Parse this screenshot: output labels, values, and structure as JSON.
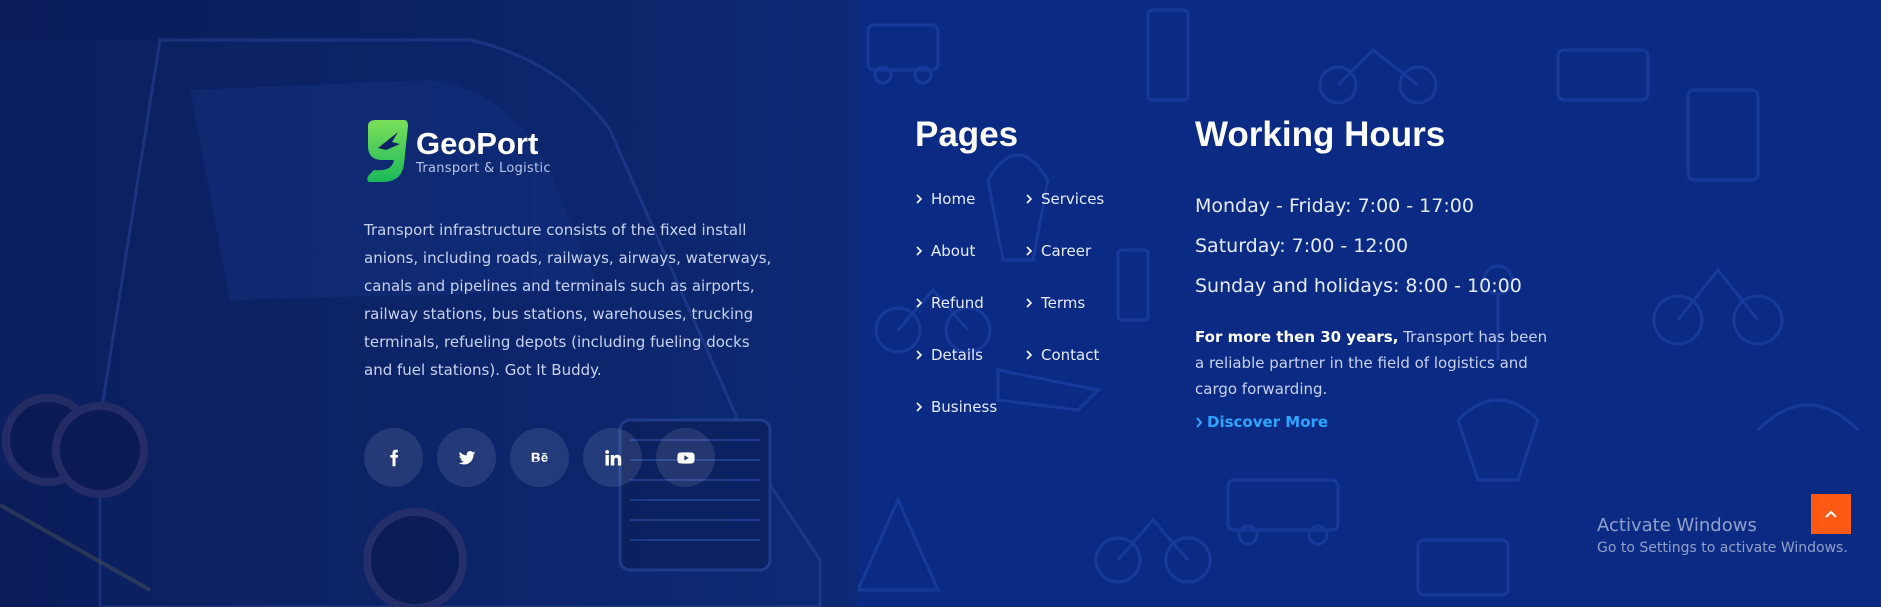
{
  "brand": {
    "name": "GeoPort",
    "tagline": "Transport & Logistic",
    "logo_icon": "plane-leaf-logo-icon",
    "accent": "#3fd15a"
  },
  "about": {
    "text": "Transport infrastructure consists of the fixed install anions, including roads, railways, airways, waterways, canals and pipelines and terminals such as airports, railway stations, bus stations, warehouses, trucking terminals, refueling depots (including fueling docks and fuel stations). Got It Buddy."
  },
  "socials": [
    {
      "icon": "facebook-icon"
    },
    {
      "icon": "twitter-icon"
    },
    {
      "icon": "behance-icon"
    },
    {
      "icon": "linkedin-icon"
    },
    {
      "icon": "youtube-icon"
    }
  ],
  "pages": {
    "title": "Pages",
    "links": [
      "Home",
      "Services",
      "About",
      "Career",
      "Refund",
      "Terms",
      "Details",
      "Contact",
      "Business"
    ]
  },
  "working_hours": {
    "title": "Working Hours",
    "lines": [
      "Monday - Friday: 7:00 - 17:00",
      "Saturday: 7:00 - 12:00",
      "Sunday and holidays: 8:00 - 10:00"
    ],
    "highlight": "For more then 30 years,",
    "text": " Transport has been a reliable partner in the field of logistics and cargo forwarding.",
    "discover_label": "Discover More",
    "discover_color": "#2ea6ff"
  },
  "os_notice": {
    "title": "Activate Windows",
    "subtitle": "Go to Settings to activate Windows."
  },
  "scroll_top": {
    "icon": "chevron-up-icon",
    "color": "#ff5a13"
  }
}
